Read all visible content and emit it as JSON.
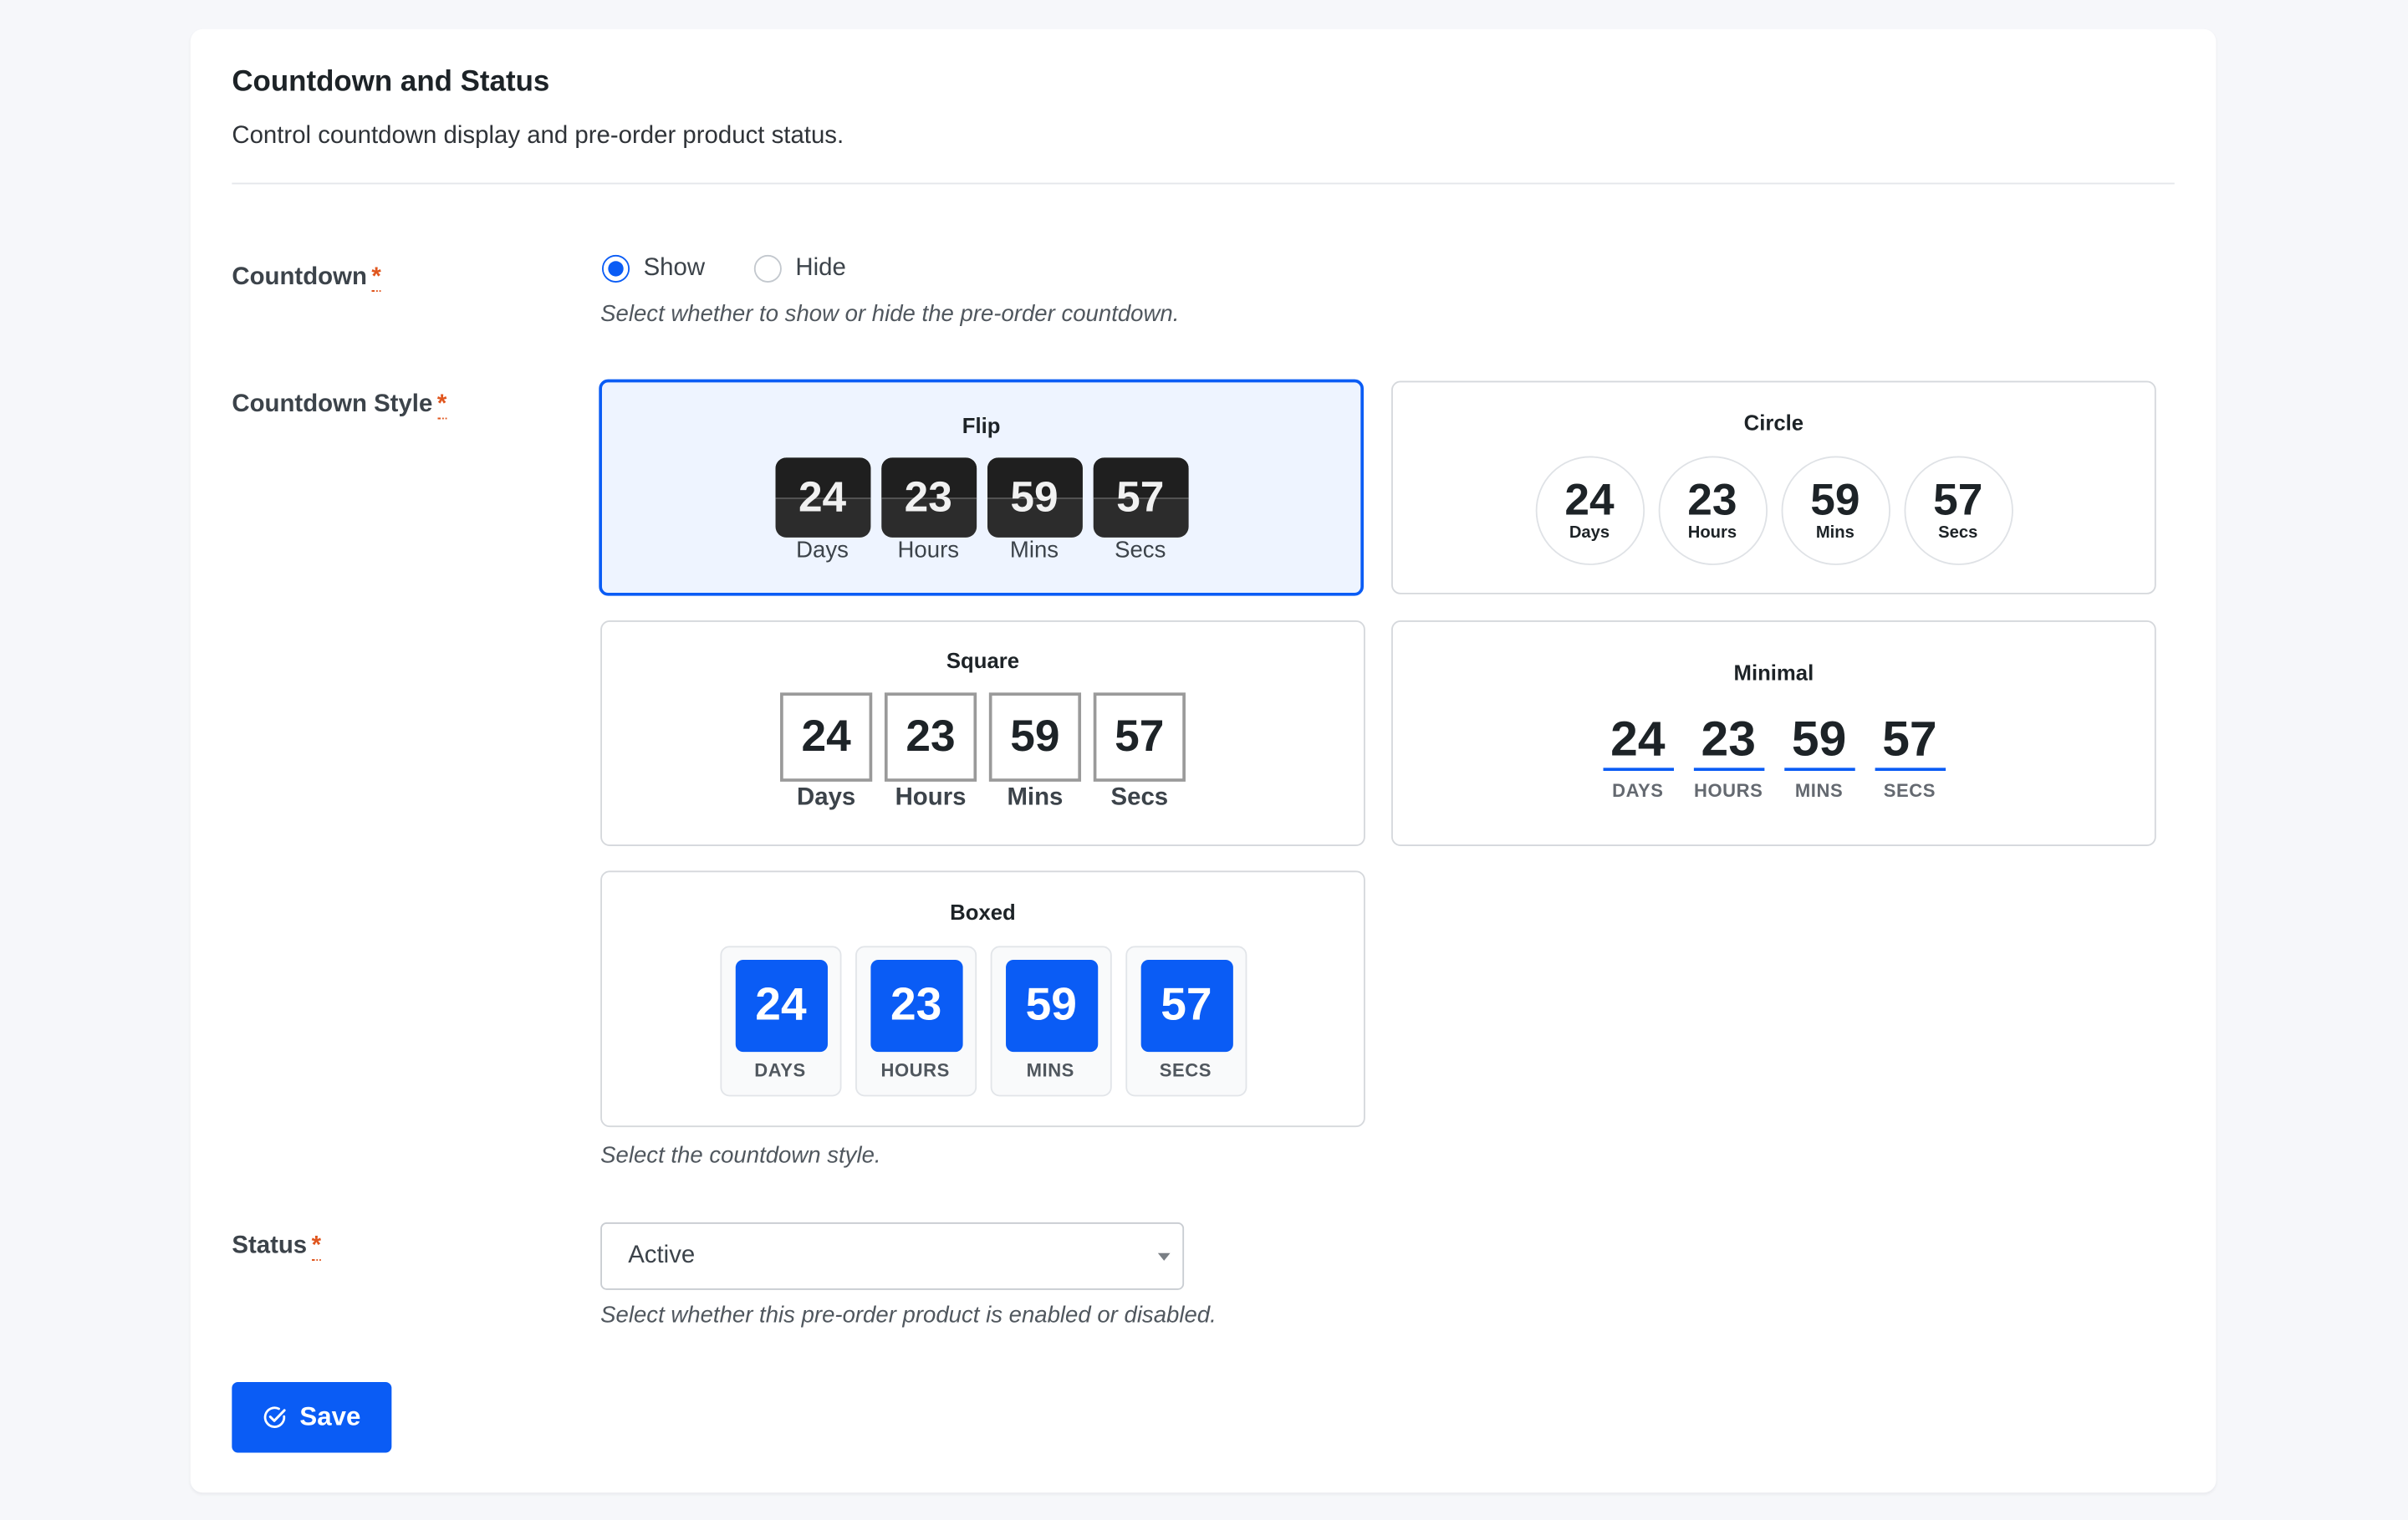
{
  "section": {
    "title": "Countdown and Status",
    "description": "Control countdown display and pre-order product status."
  },
  "countdown": {
    "label": "Countdown",
    "required_mark": "*",
    "options": [
      {
        "label": "Show",
        "checked": true
      },
      {
        "label": "Hide",
        "checked": false
      }
    ],
    "help": "Select whether to show or hide the pre-order countdown."
  },
  "countdown_style": {
    "label": "Countdown Style",
    "required_mark": "*",
    "help": "Select the countdown style.",
    "selected": "Flip",
    "styles": {
      "flip": {
        "name": "Flip",
        "units": [
          {
            "value": "24",
            "caption": "Days"
          },
          {
            "value": "23",
            "caption": "Hours"
          },
          {
            "value": "59",
            "caption": "Mins"
          },
          {
            "value": "57",
            "caption": "Secs"
          }
        ]
      },
      "circle": {
        "name": "Circle",
        "units": [
          {
            "value": "24",
            "caption": "Days"
          },
          {
            "value": "23",
            "caption": "Hours"
          },
          {
            "value": "59",
            "caption": "Mins"
          },
          {
            "value": "57",
            "caption": "Secs"
          }
        ]
      },
      "square": {
        "name": "Square",
        "units": [
          {
            "value": "24",
            "caption": "Days"
          },
          {
            "value": "23",
            "caption": "Hours"
          },
          {
            "value": "59",
            "caption": "Mins"
          },
          {
            "value": "57",
            "caption": "Secs"
          }
        ]
      },
      "minimal": {
        "name": "Minimal",
        "units": [
          {
            "value": "24",
            "caption": "DAYS"
          },
          {
            "value": "23",
            "caption": "HOURS"
          },
          {
            "value": "59",
            "caption": "MINS"
          },
          {
            "value": "57",
            "caption": "SECS"
          }
        ]
      },
      "boxed": {
        "name": "Boxed",
        "units": [
          {
            "value": "24",
            "caption": "DAYS"
          },
          {
            "value": "23",
            "caption": "HOURS"
          },
          {
            "value": "59",
            "caption": "MINS"
          },
          {
            "value": "57",
            "caption": "SECS"
          }
        ]
      }
    }
  },
  "status": {
    "label": "Status",
    "required_mark": "*",
    "value": "Active",
    "help": "Select whether this pre-order product is enabled or disabled."
  },
  "save_button": {
    "label": "Save",
    "icon": "check-circle-icon"
  },
  "colors": {
    "accent": "#0a5cf5",
    "required": "#e0561e",
    "selected_bg": "#eef4ff"
  }
}
